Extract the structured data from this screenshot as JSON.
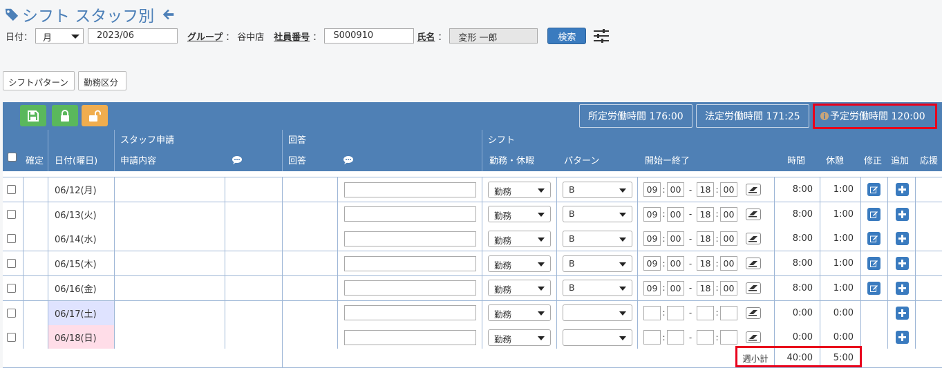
{
  "header": {
    "title": "シフト スタッフ別"
  },
  "filter": {
    "date_label": "日付：",
    "unit": "月",
    "month": "2023/06",
    "group_label": "グループ",
    "group_colon": "：",
    "group_value": "谷中店",
    "emp_label": "社員番号",
    "emp_colon": "：",
    "emp_value": "S000910",
    "name_label": "氏名",
    "name_colon": "：",
    "name_value": "変形 一郎",
    "search_label": "検索"
  },
  "tabs": {
    "shift_pattern": "シフトパターン",
    "work_type": "勤務区分"
  },
  "hours": {
    "scheduled": "所定労働時間 176:00",
    "legal": "法定労働時間 171:25",
    "planned": "予定労働時間 120:00"
  },
  "table": {
    "group_headers": {
      "staff_request": "スタッフ申請",
      "reply": "回答",
      "shift": "シフト"
    },
    "headers": {
      "confirm": "確定",
      "date": "日付(曜日)",
      "request": "申請内容",
      "reply": "回答",
      "work": "勤務・休暇",
      "pattern": "パターン",
      "start_end": "開始ー終了",
      "time": "時間",
      "break": "休憩",
      "edit": "修正",
      "add": "追加",
      "support": "応援"
    },
    "rows": [
      {
        "date": "06/12(月)",
        "work": "勤務",
        "pattern": "B",
        "sh": "09",
        "sm": "00",
        "eh": "18",
        "em": "00",
        "time": "8:00",
        "break": "1:00"
      },
      {
        "date": "06/13(火)",
        "work": "勤務",
        "pattern": "B",
        "sh": "09",
        "sm": "00",
        "eh": "18",
        "em": "00",
        "time": "8:00",
        "break": "1:00"
      },
      {
        "date": "06/14(水)",
        "work": "勤務",
        "pattern": "B",
        "sh": "09",
        "sm": "00",
        "eh": "18",
        "em": "00",
        "time": "8:00",
        "break": "1:00"
      },
      {
        "date": "06/15(木)",
        "work": "勤務",
        "pattern": "B",
        "sh": "09",
        "sm": "00",
        "eh": "18",
        "em": "00",
        "time": "8:00",
        "break": "1:00"
      },
      {
        "date": "06/16(金)",
        "work": "勤務",
        "pattern": "B",
        "sh": "09",
        "sm": "00",
        "eh": "18",
        "em": "00",
        "time": "8:00",
        "break": "1:00"
      },
      {
        "date": "06/17(土)",
        "work": "勤務",
        "pattern": "",
        "sh": "",
        "sm": "",
        "eh": "",
        "em": "",
        "time": "0:00",
        "break": "0:00"
      },
      {
        "date": "06/18(日)",
        "work": "勤務",
        "pattern": "",
        "sh": "",
        "sm": "",
        "eh": "",
        "em": "",
        "time": "0:00",
        "break": "0:00"
      }
    ],
    "subtotal": {
      "label": "週小計",
      "time": "40:00",
      "break": "5:00"
    }
  },
  "colors": {
    "header_blue": "#4f80b5",
    "saturday": "#dfe3ff",
    "sunday": "#ffdde8",
    "highlight": "#e8001c"
  }
}
